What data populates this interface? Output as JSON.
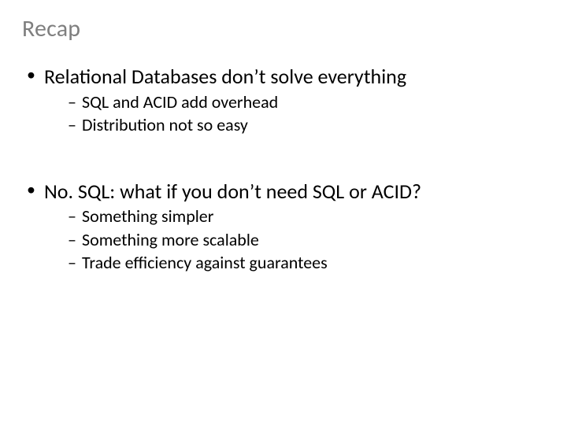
{
  "title": "Recap",
  "bullets": [
    {
      "text": "Relational Databases don’t solve everything",
      "sub": [
        "SQL and ACID add overhead",
        "Distribution not so easy"
      ]
    },
    {
      "text": "No. SQL: what if you don’t need SQL or ACID?",
      "sub": [
        "Something simpler",
        "Something more scalable",
        "Trade efficiency against guarantees"
      ]
    }
  ]
}
